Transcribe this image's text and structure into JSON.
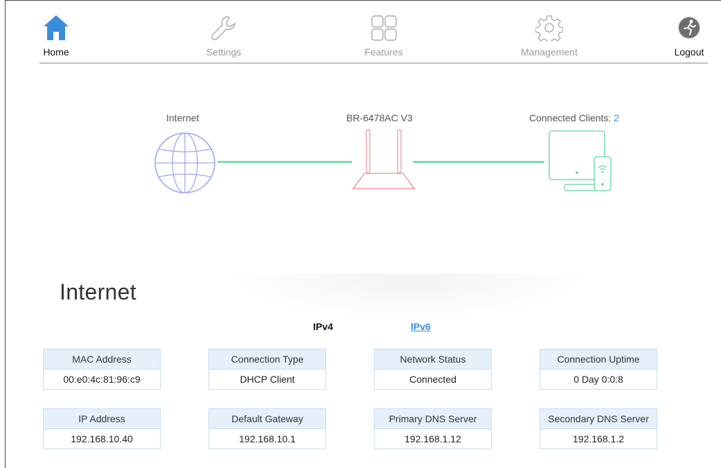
{
  "nav": {
    "items": [
      {
        "label": "Home",
        "icon": "home-icon",
        "active": true
      },
      {
        "label": "Settings",
        "icon": "wrench-icon",
        "active": false
      },
      {
        "label": "Features",
        "icon": "grid-icon",
        "active": false
      },
      {
        "label": "Management",
        "icon": "gear-icon",
        "active": false
      },
      {
        "label": "Logout",
        "icon": "logout-icon",
        "active": false
      }
    ]
  },
  "diagram": {
    "internet_label": "Internet",
    "router_label": "BR-6478AC V3",
    "clients_label": "Connected Clients:",
    "clients_count": "2",
    "colors": {
      "globe": "#9aa8f0",
      "router": "#f0a0a0",
      "clients": "#79dcae",
      "wire": "#79dcae"
    }
  },
  "internet": {
    "title": "Internet",
    "tabs": {
      "ipv4": "IPv4",
      "ipv6": "IPv6",
      "active": "IPv4"
    },
    "rows": [
      [
        {
          "header": "MAC Address",
          "value": "00:e0:4c:81:96:c9"
        },
        {
          "header": "Connection Type",
          "value": "DHCP Client"
        },
        {
          "header": "Network Status",
          "value": "Connected"
        },
        {
          "header": "Connection Uptime",
          "value": "0 Day 0:0:8"
        }
      ],
      [
        {
          "header": "IP Address",
          "value": "192.168.10.40"
        },
        {
          "header": "Default Gateway",
          "value": "192.168.10.1"
        },
        {
          "header": "Primary DNS Server",
          "value": "192.168.1.12"
        },
        {
          "header": "Secondary DNS Server",
          "value": "192.168.1.2"
        }
      ]
    ]
  }
}
